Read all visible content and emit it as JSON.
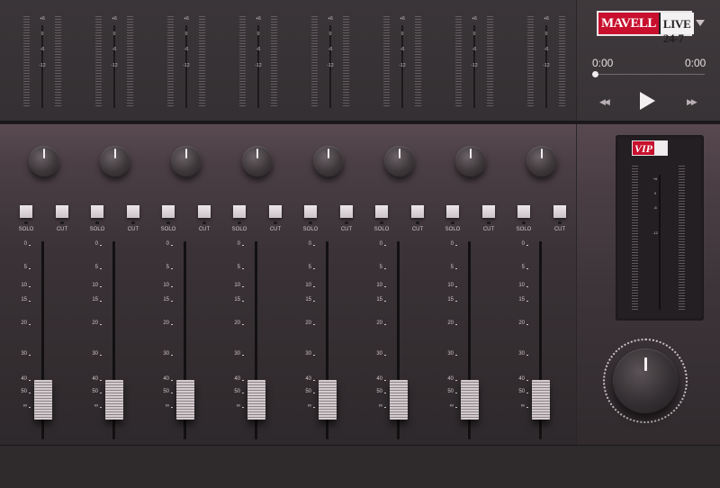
{
  "brand": {
    "part1": "MAVELL",
    "part2": "LIVE 24-7"
  },
  "player": {
    "current_time": "0:00",
    "duration": "0:00",
    "progress": 0,
    "rewind_icon": "rewind-icon",
    "play_icon": "play-icon",
    "forward_icon": "fast-forward-icon"
  },
  "top_meter_labels": [
    "+6",
    "0",
    "-6",
    "-12"
  ],
  "channels": [
    {
      "solo": "SOLO",
      "cut": "CUT",
      "fader_level": 0.15
    },
    {
      "solo": "SOLO",
      "cut": "CUT",
      "fader_level": 0.15
    },
    {
      "solo": "SOLO",
      "cut": "CUT",
      "fader_level": 0.15
    },
    {
      "solo": "SOLO",
      "cut": "CUT",
      "fader_level": 0.15
    },
    {
      "solo": "SOLO",
      "cut": "CUT",
      "fader_level": 0.15
    },
    {
      "solo": "SOLO",
      "cut": "CUT",
      "fader_level": 0.15
    },
    {
      "solo": "SOLO",
      "cut": "CUT",
      "fader_level": 0.15
    },
    {
      "solo": "SOLO",
      "cut": "CUT",
      "fader_level": 0.15
    }
  ],
  "fader_scale": [
    "0",
    "5",
    "10",
    "15",
    "20",
    "30",
    "40",
    "50",
    "∞"
  ],
  "master": {
    "badge": "VIP",
    "meter_labels": [
      "+6",
      "0",
      "-6",
      "-12"
    ]
  },
  "colors": {
    "brand_red": "#c8102e",
    "panel": "#3a3236",
    "accent_light": "#ece6e9"
  }
}
